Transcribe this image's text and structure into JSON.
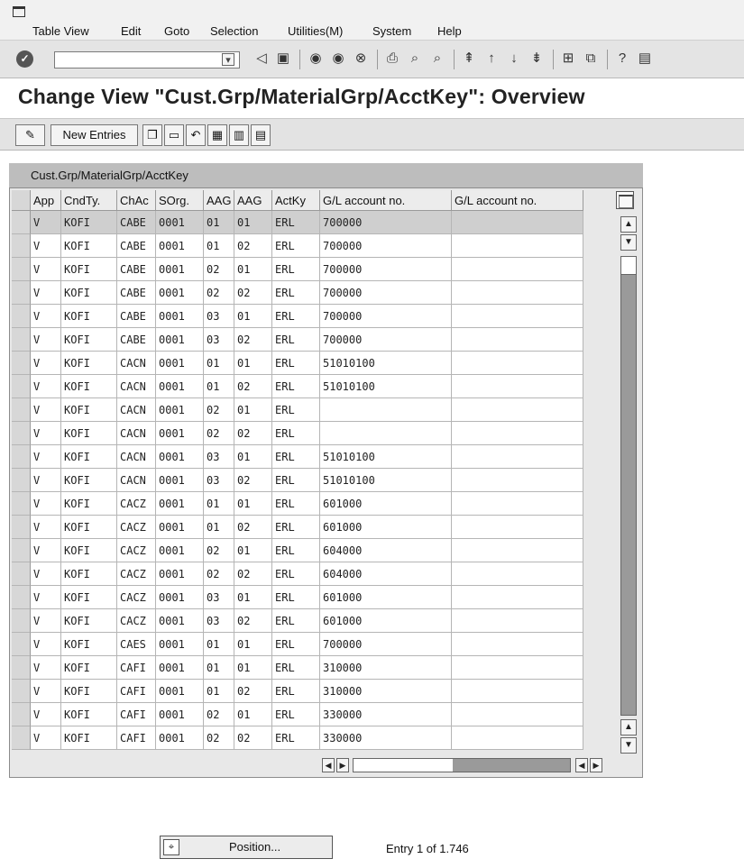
{
  "menubar": {
    "items": [
      "Table View",
      "Edit",
      "Goto",
      "Selection",
      "Utilities(M)",
      "System",
      "Help"
    ]
  },
  "toolbar": {
    "command_value": "",
    "icons": [
      "enter-icon",
      "save-icon",
      "back-icon",
      "exit-icon",
      "cancel-icon",
      "print-icon",
      "find-icon",
      "find-next-icon",
      "first-page-icon",
      "previous-page-icon",
      "next-page-icon",
      "last-page-icon",
      "create-session-icon",
      "shortcut-icon",
      "help-icon",
      "layout-icon"
    ]
  },
  "page": {
    "title": "Change View \"Cust.Grp/MaterialGrp/AcctKey\": Overview"
  },
  "app_toolbar": {
    "new_entries_label": "New Entries"
  },
  "table": {
    "title": "Cust.Grp/MaterialGrp/AcctKey",
    "columns": [
      "App",
      "CndTy.",
      "ChAc",
      "SOrg.",
      "AAG",
      "AAG",
      "ActKy",
      "G/L account no.",
      "G/L account no."
    ],
    "rows": [
      [
        "V",
        "KOFI",
        "CABE",
        "0001",
        "01",
        "01",
        "ERL",
        "700000",
        ""
      ],
      [
        "V",
        "KOFI",
        "CABE",
        "0001",
        "01",
        "02",
        "ERL",
        "700000",
        ""
      ],
      [
        "V",
        "KOFI",
        "CABE",
        "0001",
        "02",
        "01",
        "ERL",
        "700000",
        ""
      ],
      [
        "V",
        "KOFI",
        "CABE",
        "0001",
        "02",
        "02",
        "ERL",
        "700000",
        ""
      ],
      [
        "V",
        "KOFI",
        "CABE",
        "0001",
        "03",
        "01",
        "ERL",
        "700000",
        ""
      ],
      [
        "V",
        "KOFI",
        "CABE",
        "0001",
        "03",
        "02",
        "ERL",
        "700000",
        ""
      ],
      [
        "V",
        "KOFI",
        "CACN",
        "0001",
        "01",
        "01",
        "ERL",
        "51010100",
        ""
      ],
      [
        "V",
        "KOFI",
        "CACN",
        "0001",
        "01",
        "02",
        "ERL",
        "51010100",
        ""
      ],
      [
        "V",
        "KOFI",
        "CACN",
        "0001",
        "02",
        "01",
        "ERL",
        "",
        ""
      ],
      [
        "V",
        "KOFI",
        "CACN",
        "0001",
        "02",
        "02",
        "ERL",
        "",
        ""
      ],
      [
        "V",
        "KOFI",
        "CACN",
        "0001",
        "03",
        "01",
        "ERL",
        "51010100",
        ""
      ],
      [
        "V",
        "KOFI",
        "CACN",
        "0001",
        "03",
        "02",
        "ERL",
        "51010100",
        ""
      ],
      [
        "V",
        "KOFI",
        "CACZ",
        "0001",
        "01",
        "01",
        "ERL",
        "601000",
        ""
      ],
      [
        "V",
        "KOFI",
        "CACZ",
        "0001",
        "01",
        "02",
        "ERL",
        "601000",
        ""
      ],
      [
        "V",
        "KOFI",
        "CACZ",
        "0001",
        "02",
        "01",
        "ERL",
        "604000",
        ""
      ],
      [
        "V",
        "KOFI",
        "CACZ",
        "0001",
        "02",
        "02",
        "ERL",
        "604000",
        ""
      ],
      [
        "V",
        "KOFI",
        "CACZ",
        "0001",
        "03",
        "01",
        "ERL",
        "601000",
        ""
      ],
      [
        "V",
        "KOFI",
        "CACZ",
        "0001",
        "03",
        "02",
        "ERL",
        "601000",
        ""
      ],
      [
        "V",
        "KOFI",
        "CAES",
        "0001",
        "01",
        "01",
        "ERL",
        "700000",
        ""
      ],
      [
        "V",
        "KOFI",
        "CAFI",
        "0001",
        "01",
        "01",
        "ERL",
        "310000",
        ""
      ],
      [
        "V",
        "KOFI",
        "CAFI",
        "0001",
        "01",
        "02",
        "ERL",
        "310000",
        ""
      ],
      [
        "V",
        "KOFI",
        "CAFI",
        "0001",
        "02",
        "01",
        "ERL",
        "330000",
        ""
      ],
      [
        "V",
        "KOFI",
        "CAFI",
        "0001",
        "02",
        "02",
        "ERL",
        "330000",
        ""
      ]
    ],
    "selected_row": 0
  },
  "footer": {
    "position_label": "Position...",
    "entry_text": "Entry 1 of 1.746"
  }
}
